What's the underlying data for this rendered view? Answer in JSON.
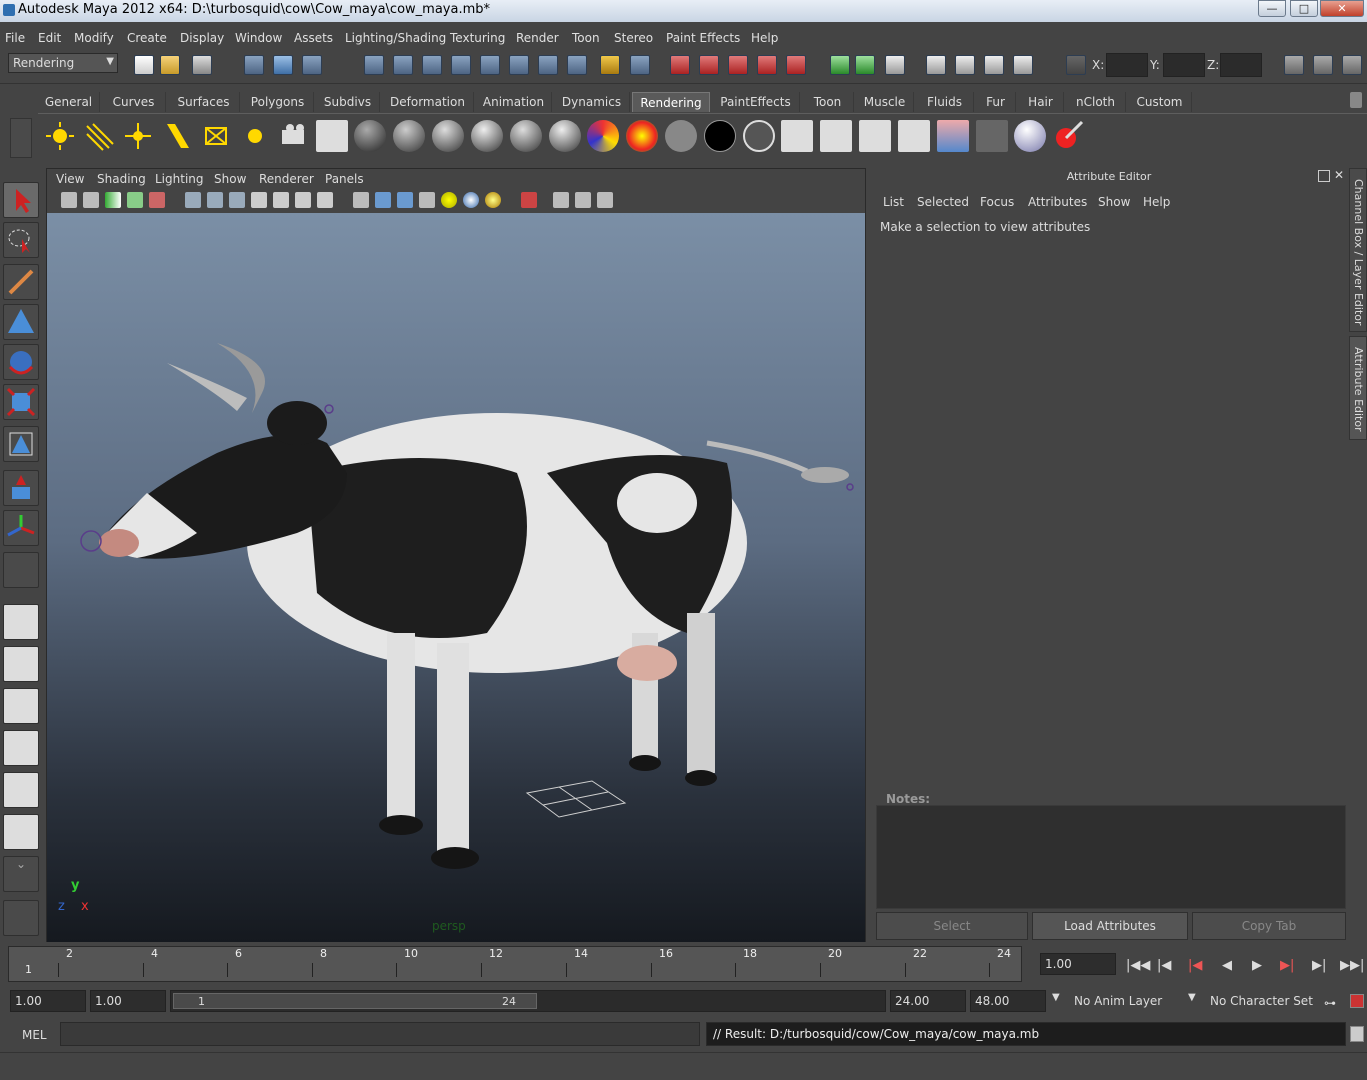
{
  "window": {
    "title": "Autodesk Maya 2012 x64: D:\\turbosquid\\cow\\Cow_maya\\cow_maya.mb*"
  },
  "menu": [
    "File",
    "Edit",
    "Modify",
    "Create",
    "Display",
    "Window",
    "Assets",
    "Lighting/Shading",
    "Texturing",
    "Render",
    "Toon",
    "Stereo",
    "Paint Effects",
    "Help"
  ],
  "status": {
    "mode": "Rendering",
    "x_label": "X:",
    "y_label": "Y:",
    "z_label": "Z:"
  },
  "shelf_tabs": [
    "General",
    "Curves",
    "Surfaces",
    "Polygons",
    "Subdivs",
    "Deformation",
    "Animation",
    "Dynamics",
    "Rendering",
    "PaintEffects",
    "Toon",
    "Muscle",
    "Fluids",
    "Fur",
    "Hair",
    "nCloth",
    "Custom"
  ],
  "active_shelf": "Rendering",
  "viewport": {
    "menu": [
      "View",
      "Shading",
      "Lighting",
      "Show",
      "Renderer",
      "Panels"
    ],
    "camera": "persp",
    "axis_y": "y",
    "axis_x": "x",
    "axis_z": "z"
  },
  "attribute_editor": {
    "title": "Attribute Editor",
    "menu": [
      "List",
      "Selected",
      "Focus",
      "Attributes",
      "Show",
      "Help"
    ],
    "message": "Make a selection to view attributes",
    "notes_label": "Notes:",
    "buttons": {
      "select": "Select",
      "load": "Load Attributes",
      "copy": "Copy Tab"
    }
  },
  "side_tabs": {
    "channel_box": "Channel Box / Layer Editor",
    "attr_editor": "Attribute Editor"
  },
  "timeline": {
    "current_frame": "1",
    "ticks": [
      "2",
      "4",
      "6",
      "8",
      "10",
      "12",
      "14",
      "16",
      "18",
      "20",
      "22",
      "24"
    ],
    "current_time": "1.00"
  },
  "range": {
    "start": "1.00",
    "start2": "1.00",
    "slider_start": "1",
    "slider_end": "24",
    "end": "24.00",
    "end2": "48.00",
    "anim_layer": "No Anim Layer",
    "char_set": "No Character Set"
  },
  "command": {
    "mode": "MEL",
    "result": "// Result: D:/turbosquid/cow/Cow_maya/cow_maya.mb"
  },
  "colors": {
    "accent": "#5a5a5a",
    "bg": "#444444"
  }
}
